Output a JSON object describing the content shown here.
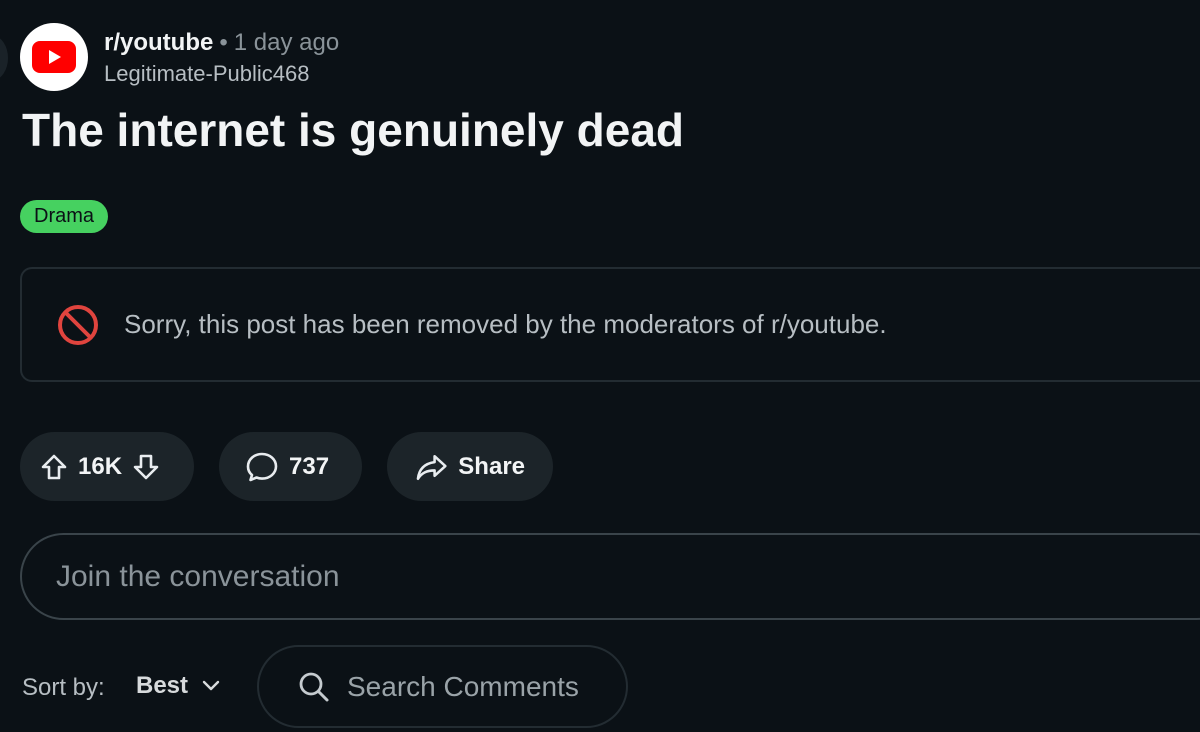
{
  "post": {
    "subreddit": "r/youtube",
    "separator": "•",
    "time": "1 day ago",
    "author": "Legitimate-Public468",
    "title": "The internet is genuinely dead",
    "flair": "Drama",
    "removed_notice": "Sorry, this post has been removed by the moderators of r/youtube."
  },
  "actions": {
    "votes": "16K",
    "comments": "737",
    "share_label": "Share"
  },
  "comment_box": {
    "placeholder": "Join the conversation"
  },
  "sort": {
    "label": "Sort by:",
    "value": "Best"
  },
  "search": {
    "placeholder": "Search Comments"
  },
  "icons": {
    "avatar": "youtube-logo-icon",
    "notice": "prohibited-icon",
    "upvote": "arrow-up-icon",
    "downvote": "arrow-down-icon",
    "comment": "speech-bubble-icon",
    "share": "share-arrow-icon",
    "sort": "chevron-down-icon",
    "search": "magnifier-icon"
  },
  "colors": {
    "background": "#0b1116",
    "flair": "#46d160",
    "youtube_red": "#ff0000",
    "notice_icon": "#e0443e",
    "pill": "#1c2429"
  }
}
